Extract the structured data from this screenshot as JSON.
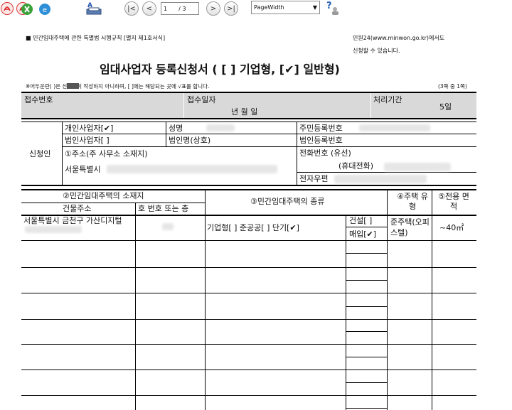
{
  "toolbar": {
    "page_current": "1",
    "page_total": "/ 3",
    "zoom_value": "PageWidth",
    "nav_first": "|<",
    "nav_prev": "<",
    "nav_next": ">",
    "nav_last": ">|",
    "icons": [
      "pdf-export-icon",
      "pdf-icon",
      "excel-icon",
      "hwp-icon",
      "print-icon",
      "help-icon"
    ]
  },
  "doc": {
    "header_left": "■ 민간임대주택에 관한 특별법 시행규칙 [별지 제1호서식]",
    "header_right_1": "민원24(www.minwon.go.kr)에서도",
    "header_right_2": "신청할 수 있습니다.",
    "title": "임대사업자 등록신청서 ( [ ] 기업형, [✔] 일반형)",
    "note": "※어두운란(     )은 신고인이 작성하지 아니하며, [  ]에는 해당되는 곳에 √표를 합니다.",
    "page_indicator": "(3쪽 중 1쪽)",
    "receipt_no_label": "접수번호",
    "receipt_date_label": "접수일자",
    "receipt_date_value": "년   월   일",
    "processing_period_label": "처리기간",
    "processing_period_value": "5일",
    "applicant_label": "신청인",
    "individual_label": "개인사업자[✔]",
    "corporate_label": "법인사업자[  ]",
    "name_label": "성명",
    "corp_name_label": "법인명(상호)",
    "resident_no_label": "주민등록번호",
    "corp_reg_no_label": "법인등록번호",
    "address_label": "①주소(주 사무소 소재지)",
    "address_value": "서울특별시",
    "phone_label": "전화번호 (유선)",
    "mobile_label": "(휴대전화)",
    "email_label": "전자우편",
    "housing_location_label": "②민간임대주택의 소재지",
    "building_address_label": "건물주소",
    "unit_label": "호 번호 또는 층",
    "housing_type_header": "③민간임대주택의 종류",
    "housing_kind_label": "④주택 유형",
    "area_label": "⑤전용 면적",
    "row1_address": "서울특별시 금천구 가산디지털",
    "row1_types": "기업형[  ] 준공공[  ]  단기[✔]",
    "construct_label": "건설[  ]",
    "purchase_label": "매입[✔]",
    "house_type_value": "준주택(오피스텔)",
    "area_value": "~40㎡"
  }
}
